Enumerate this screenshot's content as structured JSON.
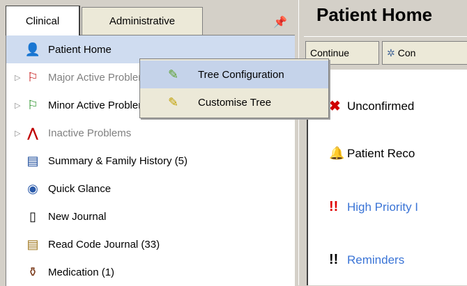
{
  "tabs": {
    "clinical": "Clinical",
    "administrative": "Administrative"
  },
  "tree": {
    "items": [
      {
        "label": "Patient Home",
        "icon": "patient-home-icon",
        "glyph": "👤",
        "expander": "",
        "muted": false,
        "selected": true
      },
      {
        "label": "Major Active Problems",
        "icon": "major-problems-icon",
        "glyph": "⚐",
        "expander": "▷",
        "muted": true,
        "selected": false
      },
      {
        "label": "Minor Active Problems",
        "icon": "minor-problems-icon",
        "glyph": "⚐",
        "expander": "▷",
        "muted": false,
        "selected": false
      },
      {
        "label": "Inactive Problems",
        "icon": "inactive-problems-icon",
        "glyph": "⋀",
        "expander": "▷",
        "muted": true,
        "selected": false
      },
      {
        "label": "Summary & Family History (5)",
        "icon": "summary-icon",
        "glyph": "▤",
        "expander": "",
        "muted": false,
        "selected": false
      },
      {
        "label": "Quick Glance",
        "icon": "eye-icon",
        "glyph": "◉",
        "expander": "",
        "muted": false,
        "selected": false
      },
      {
        "label": "New Journal",
        "icon": "journal-icon",
        "glyph": "▯",
        "expander": "",
        "muted": false,
        "selected": false
      },
      {
        "label": "Read Code Journal (33)",
        "icon": "read-code-journal-icon",
        "glyph": "▤",
        "expander": "",
        "muted": false,
        "selected": false
      },
      {
        "label": "Medication (1)",
        "icon": "medication-icon",
        "glyph": "⚱",
        "expander": "",
        "muted": false,
        "selected": false
      }
    ]
  },
  "context_menu": {
    "items": [
      {
        "label": "Tree Configuration",
        "icon": "pencil-icon",
        "glyph": "✎"
      },
      {
        "label": "Customise Tree",
        "icon": "wand-icon",
        "glyph": "✎"
      }
    ]
  },
  "right": {
    "title": "Patient Home",
    "toolbar": {
      "continue_label": "Continue",
      "con_label": "Con"
    },
    "items": [
      {
        "label": "Unconfirmed",
        "icon": "unconfirmed-icon",
        "glyph": "✖",
        "link": false
      },
      {
        "label": "Patient Reco",
        "icon": "alarm-icon",
        "glyph": "🔔",
        "link": false
      },
      {
        "label": "High Priority I",
        "icon": "high-priority-icon",
        "glyph": "!!",
        "link": true
      },
      {
        "label": "Reminders",
        "icon": "reminders-icon",
        "glyph": "!!",
        "link": true
      }
    ]
  },
  "colors": {
    "selected_row": "#cfdcf0",
    "link": "#3a74d6",
    "high_priority": "#e00000"
  }
}
